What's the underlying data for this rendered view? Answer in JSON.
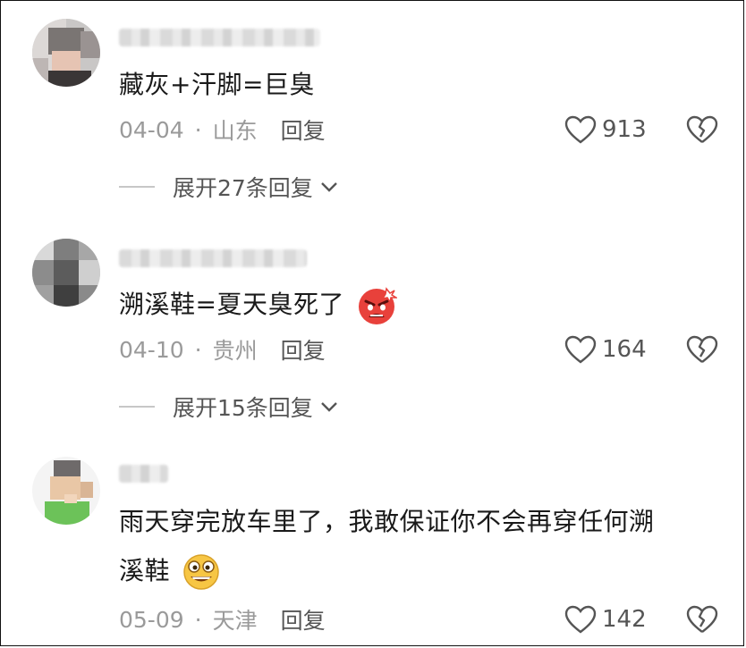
{
  "comments": [
    {
      "text": "藏灰+汗脚=巨臭",
      "date": "04-04",
      "location": "山东",
      "reply_label": "回复",
      "likes": "913",
      "expand_label": "展开27条回复"
    },
    {
      "text": "溯溪鞋=夏天臭死了",
      "date": "04-10",
      "location": "贵州",
      "reply_label": "回复",
      "likes": "164",
      "expand_label": "展开15条回复",
      "emoji": "angry-face-emoji"
    },
    {
      "text_line1": "雨天穿完放车里了，我敢保证你不会再穿任何溯",
      "text_line2": "溪鞋",
      "date": "05-09",
      "location": "天津",
      "reply_label": "回复",
      "likes": "142",
      "emoji": "grinning-face-emoji"
    }
  ],
  "separator": "·",
  "colors": {
    "text": "#1a1a1a",
    "meta": "#9a9a9a",
    "action": "#555555"
  }
}
